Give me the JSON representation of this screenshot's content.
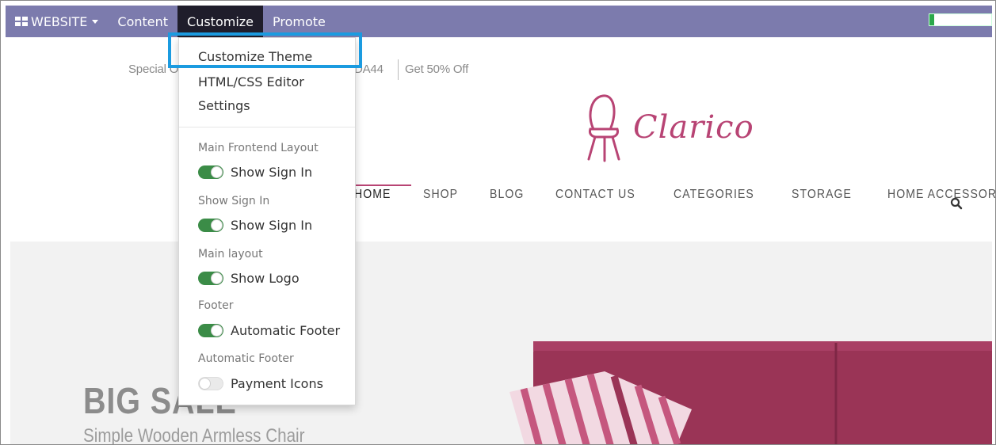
{
  "topbar": {
    "website_label": "WEBSITE",
    "content_label": "Content",
    "customize_label": "Customize",
    "promote_label": "Promote"
  },
  "promo": {
    "left_text": "Special O",
    "code_text": "DA44",
    "offer_text": "Get 50% Off"
  },
  "brand": {
    "name": "Clarico",
    "color": "#b84474"
  },
  "nav": {
    "items": [
      "HOME",
      "SHOP",
      "BLOG",
      "CONTACT US",
      "CATEGORIES",
      "STORAGE",
      "HOME ACCESSORIES"
    ]
  },
  "hero": {
    "title": "BIG SALE",
    "subtitle": "Simple Wooden Armless Chair"
  },
  "dropdown": {
    "items": [
      "Customize Theme",
      "HTML/CSS Editor",
      "Settings"
    ],
    "sections": [
      {
        "header": "Main Frontend Layout",
        "toggle": "Show Sign In",
        "on": true
      },
      {
        "header": "Show Sign In",
        "toggle": "Show Sign In",
        "on": true
      },
      {
        "header": "Main layout",
        "toggle": "Show Logo",
        "on": true
      },
      {
        "header": "Footer",
        "toggle": "Automatic Footer",
        "on": true
      },
      {
        "header": "Automatic Footer",
        "toggle": "Payment Icons",
        "on": false
      }
    ]
  },
  "colors": {
    "topbar": "#7c7bad",
    "active_menu": "#1f1d2b",
    "toggle_on": "#3b8c47",
    "highlight": "#1b9be0"
  }
}
